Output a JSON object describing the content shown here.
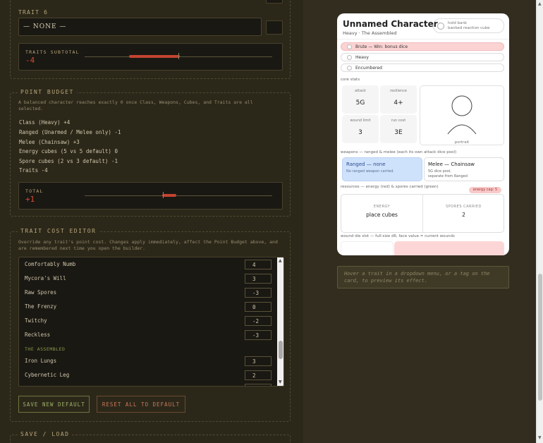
{
  "trait6": {
    "label": "TRAIT 6",
    "value": "— NONE —",
    "button": ""
  },
  "traits_subtotal": {
    "label": "TRAITS SUBTOTAL",
    "value": "-4"
  },
  "point_budget": {
    "title": "POINT BUDGET",
    "desc": "A balanced character reaches exactly 0 once Class, Weapons, Cubes, and Traits are all selected.",
    "lines": [
      "Class (Heavy)   +4",
      "Ranged (Unarmed / Melee only)   -1",
      "Melee (Chainsaw)   +3",
      "Energy cubes (5 vs 5 default)   0",
      "Spore cubes (2 vs 3 default)   -1",
      "Traits   -4"
    ],
    "total_label": "TOTAL",
    "total_value": "+1"
  },
  "cost_editor": {
    "title": "TRAIT COST EDITOR",
    "desc": "Override any trait's point cost. Changes apply immediately, affect the Point Budget above, and are remembered next time you open the builder.",
    "rows": [
      {
        "name": "Comfortably Numb",
        "value": "4"
      },
      {
        "name": "Mycora's Will",
        "value": "3"
      },
      {
        "name": "Raw Spores",
        "value": "-3"
      },
      {
        "name": "The Frenzy",
        "value": "0"
      },
      {
        "name": "Twitchy",
        "value": "-2"
      },
      {
        "name": "Reckless",
        "value": "-3"
      }
    ],
    "group": "THE ASSEMBLED",
    "group_rows": [
      {
        "name": "Iron Lungs",
        "value": "3"
      },
      {
        "name": "Cybernetic Leg",
        "value": "2"
      }
    ],
    "save_default": "SAVE NEW DEFAULT",
    "reset_default": "RESET ALL TO DEFAULT"
  },
  "save_load": {
    "title": "SAVE / LOAD"
  },
  "card": {
    "name": "Unnamed Character",
    "subtitle": "Heavy · The Assembled",
    "hold": {
      "line1": "hold bank",
      "line2": "banked reaction cube"
    },
    "tags": [
      "Brute — Win: bonus dice",
      "Heavy",
      "Encumbered"
    ],
    "core_label": "core stats",
    "stats": [
      {
        "k": "attack",
        "v": "5G"
      },
      {
        "k": "resilience",
        "v": "4+"
      },
      {
        "k": "wound limit",
        "v": "3"
      },
      {
        "k": "run cost",
        "v": "3E"
      }
    ],
    "portrait_label": "portrait",
    "weapons_label": "weapons — ranged & melee (each its own attack dice pool)",
    "ranged": {
      "title": "Ranged — none",
      "desc": "No ranged weapon carried."
    },
    "melee": {
      "title": "Melee — Chainsaw",
      "desc1": "5G dice pool,",
      "desc2": "separate from Ranged"
    },
    "resources_label": "resources — energy (red) & spores carried (green)",
    "energy_cap": "energy cap: 5",
    "energy": {
      "k": "ENERGY",
      "v": "place cubes"
    },
    "spores": {
      "k": "SPORES CARRIED",
      "v": "2"
    },
    "wound_label": "wound die slot — full-size d6, face value = current wounds",
    "colors": {
      "accent_red": "#fbd3d3"
    }
  },
  "hint": "Hover a trait in a dropdown menu, or a tag on the card, to preview its effect."
}
